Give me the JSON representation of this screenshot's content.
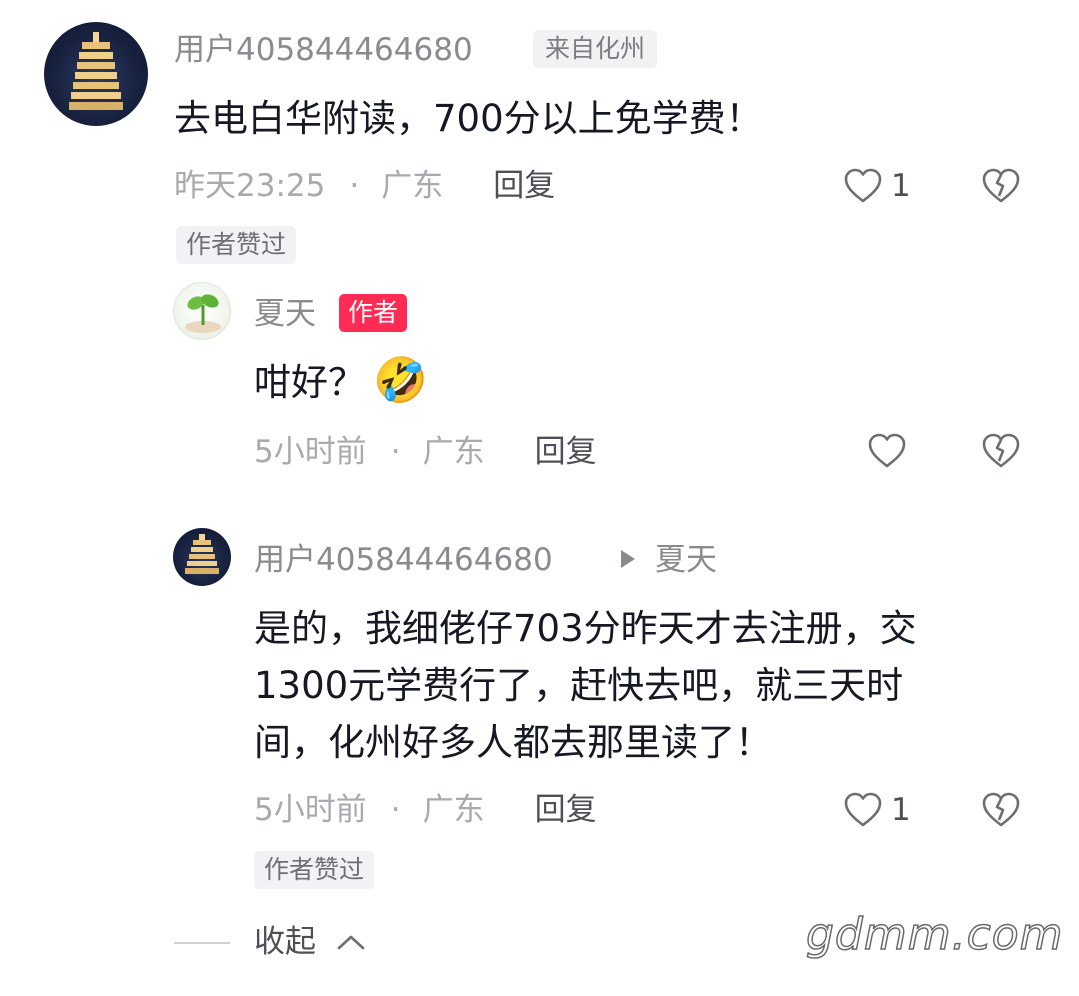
{
  "comment1": {
    "username": "用户405844464680",
    "location_badge": "来自化州",
    "content": "去电白华附读，700分以上免学费！",
    "time": "昨天23:25",
    "separator": "·",
    "location": "广东",
    "reply_label": "回复",
    "like_count": "1",
    "liked_badge": "作者赞过"
  },
  "reply1": {
    "username": "夏天",
    "author_badge": "作者",
    "content": "咁好？",
    "emoji": "🤣",
    "time": "5小时前",
    "separator": "·",
    "location": "广东",
    "reply_label": "回复"
  },
  "reply2": {
    "username": "用户405844464680",
    "reply_to": "夏天",
    "content_lines": [
      "是的，我细佬仔703分昨天才去注册，交",
      "1300元学费行了，赶快去吧，就三天时",
      "间，化州好多人都去那里读了！"
    ],
    "time": "5小时前",
    "separator": "·",
    "location": "广东",
    "reply_label": "回复",
    "like_count": "1",
    "liked_badge": "作者赞过"
  },
  "collapse_label": "收起",
  "watermark": "gdmm.com",
  "icons": {
    "like": "heart-outline-icon",
    "dislike": "broken-heart-icon",
    "reply_arrow": "triangle-right-icon",
    "collapse": "chevron-up-icon"
  },
  "colors": {
    "author_badge": "#fe2c55",
    "text_primary": "#161823",
    "text_secondary": "#8a8b91"
  }
}
